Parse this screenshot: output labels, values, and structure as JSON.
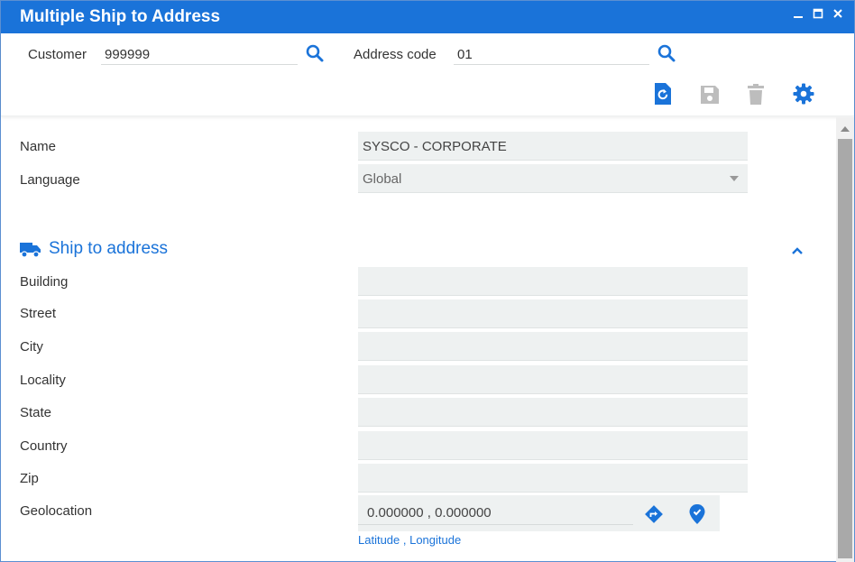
{
  "window": {
    "title": "Multiple Ship to Address",
    "controls": [
      "minimize-icon",
      "maximize-icon",
      "close-icon"
    ]
  },
  "header": {
    "customer_label": "Customer",
    "customer_value": "999999",
    "address_code_label": "Address code",
    "address_code_value": "01",
    "toolbar": [
      "refresh-icon",
      "save-icon",
      "delete-icon",
      "gear-icon"
    ]
  },
  "form": {
    "name_label": "Name",
    "name_value": "SYSCO - CORPORATE",
    "language_label": "Language",
    "language_value": "Global"
  },
  "ship_to": {
    "title": "Ship to address",
    "building_label": "Building",
    "building_value": "",
    "street_label": "Street",
    "street_value": "",
    "city_label": "City",
    "city_value": "",
    "locality_label": "Locality",
    "locality_value": "",
    "state_label": "State",
    "state_value": "",
    "country_label": "Country",
    "country_value": "",
    "zip_label": "Zip",
    "zip_value": "",
    "geolocation_label": "Geolocation",
    "geolocation_value": "0.000000 ,  0.000000",
    "geolocation_hint": "Latitude , Longitude"
  },
  "colors": {
    "accent": "#1a73d9",
    "field_bg": "#eef1f1",
    "disabled_icon": "#bdbdbd"
  }
}
